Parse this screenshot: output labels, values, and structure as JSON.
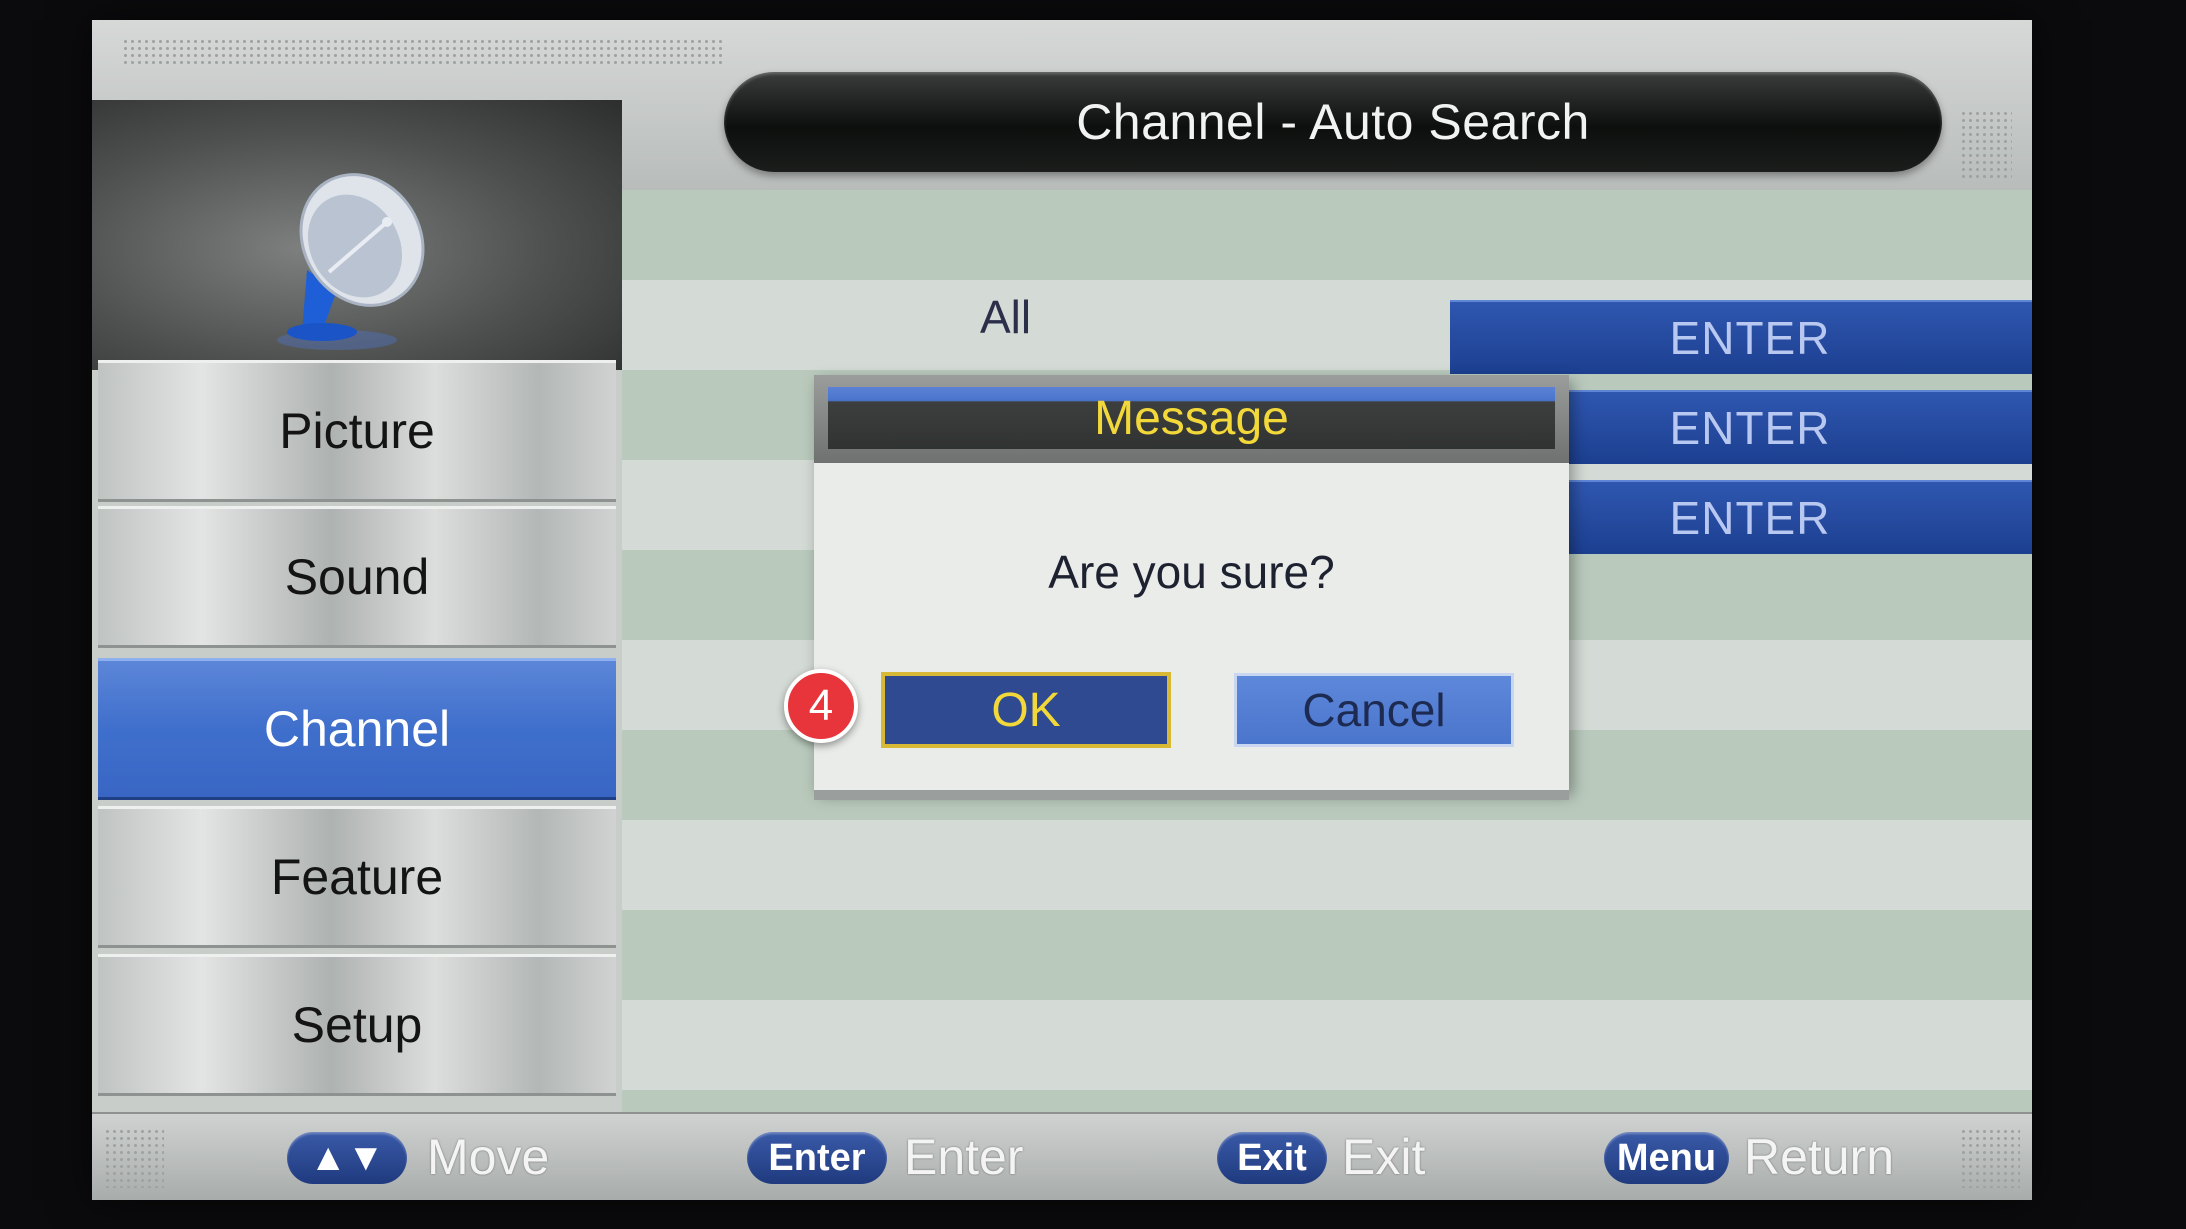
{
  "header": {
    "title": "Channel - Auto Search"
  },
  "sidebar": {
    "items": [
      {
        "label": "Picture"
      },
      {
        "label": "Sound"
      },
      {
        "label": "Channel"
      },
      {
        "label": "Feature"
      },
      {
        "label": "Setup"
      }
    ],
    "active": "Channel"
  },
  "content": {
    "rows": [
      {
        "label": "All",
        "button": "ENTER"
      },
      {
        "label": "",
        "button": "ENTER"
      },
      {
        "label": "",
        "button": "ENTER"
      }
    ]
  },
  "dialog": {
    "title": "Message",
    "text": "Are you sure?",
    "ok_label": "OK",
    "cancel_label": "Cancel"
  },
  "step_badge": "4",
  "footer": {
    "hints": [
      {
        "key": "▲▼",
        "label": "Move"
      },
      {
        "key": "Enter",
        "label": "Enter"
      },
      {
        "key": "Exit",
        "label": "Exit"
      },
      {
        "key": "Menu",
        "label": "Return"
      }
    ]
  },
  "colors": {
    "accent_blue": "#3f6fcc",
    "highlight_yellow": "#f3d83a",
    "badge_red": "#e8353b"
  }
}
